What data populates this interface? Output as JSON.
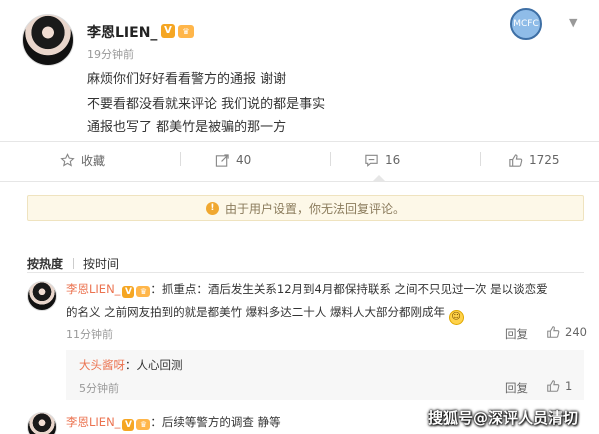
{
  "post": {
    "username": "李恩LIEN_",
    "verified_badge": "V",
    "time": "19分钟前",
    "lines": [
      "麻烦你们好好看看警方的通报  谢谢",
      "不要看都没看就来评论  我们说的都是事实",
      "通报也写了  都美竹是被骗的那一方"
    ],
    "expand_icon": "chevron-down-icon",
    "club_logo_text": "MCFC"
  },
  "actions": {
    "favorite_label": "收藏",
    "repost_count": "40",
    "comment_count": "16",
    "like_count": "1725"
  },
  "notice": {
    "text": "由于用户设置，你无法回复评论。"
  },
  "sort": {
    "hot": "按热度",
    "time": "按时间"
  },
  "comments": [
    {
      "name": "李恩LIEN_",
      "badge": "V",
      "text_line1": "：抓重点：酒后发生关系12月到4月都保持联系  之间不只见过一次  是以谈恋爱",
      "text_line2": "的名义  之前网友拍到的就是都美竹  爆料多达二十人  爆料人大部分都刚成年",
      "time": "11分钟前",
      "reply_label": "回复",
      "likes": "240",
      "replies": [
        {
          "name": "大头酱呀",
          "text": "：人心回测",
          "time": "5分钟前",
          "reply_label": "回复",
          "likes": "1"
        }
      ]
    },
    {
      "name": "李恩LIEN_",
      "badge": "V",
      "text_line1": "：后续等警方的调查  静等"
    }
  ],
  "watermark": "搜狐号@深评人员清切",
  "colors": {
    "name_orange": "#eb7350",
    "notice_bg": "#fdf8e8",
    "badge_gold": "#f5a623"
  }
}
